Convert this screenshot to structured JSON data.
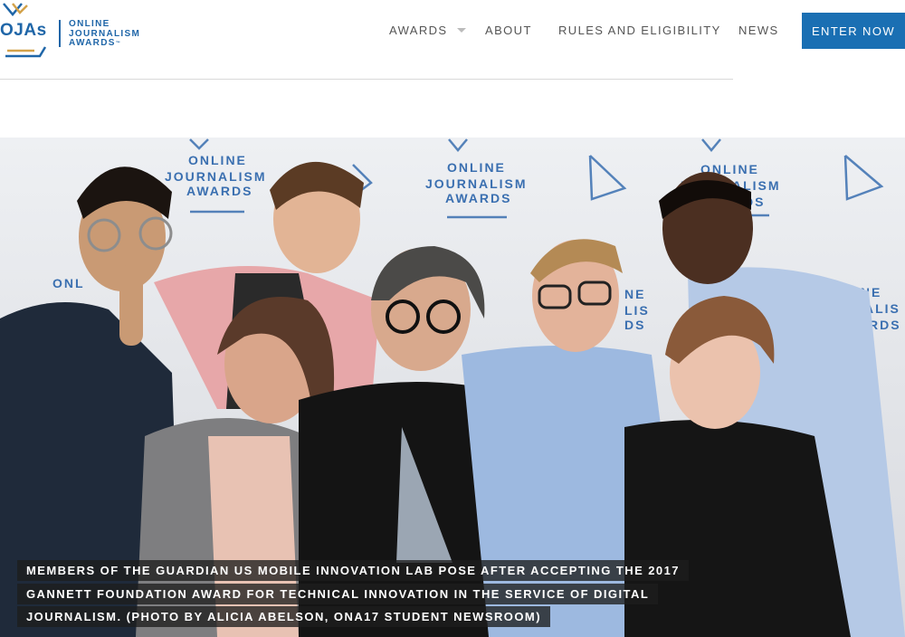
{
  "logo": {
    "abbr": "OJAs",
    "line1": "ONLINE",
    "line2": "JOURNALISM",
    "line3": "AWARDS",
    "trademark": "™",
    "icon": "oja-triangle-logo-icon"
  },
  "nav": {
    "awards_label": "AWARDS",
    "about_label": "ABOUT",
    "rules_label": "RULES AND ELIGIBILITY",
    "news_label": "NEWS",
    "enter_label": "ENTER NOW"
  },
  "hero": {
    "backdrop_text": [
      "ONLINE",
      "JOURNALISM",
      "AWARDS"
    ],
    "caption": "MEMBERS OF THE GUARDIAN US MOBILE INNOVATION LAB POSE AFTER ACCEPTING THE 2017 GANNETT FOUNDATION AWARD FOR TECHNICAL INNOVATION IN THE SERVICE OF DIGITAL JOURNALISM. (PHOTO BY ALICIA ABELSON, ONA17 STUDENT NEWSROOM)"
  },
  "colors": {
    "brand_blue": "#1a6fb3",
    "logo_gold": "#d3a24a",
    "nav_text": "#555555"
  }
}
